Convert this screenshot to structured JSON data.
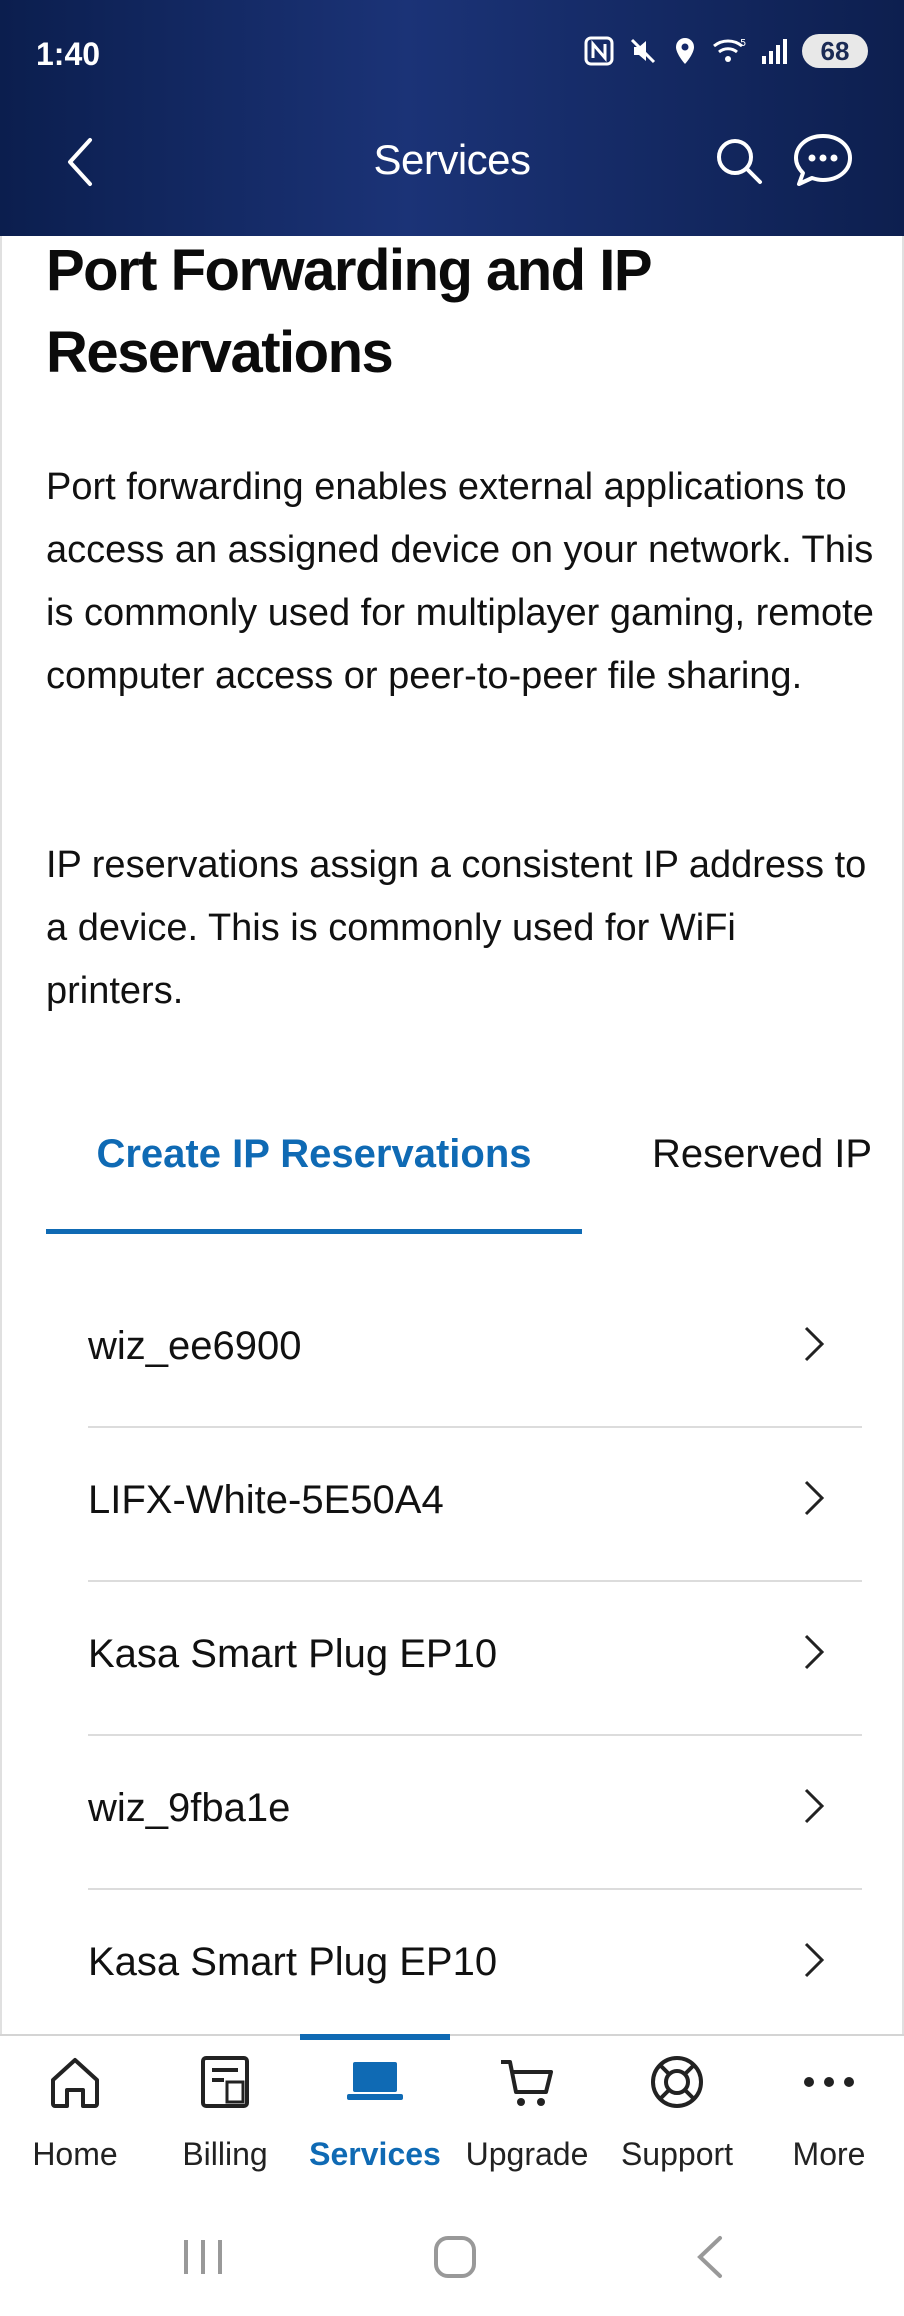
{
  "status_bar": {
    "time": "1:40",
    "battery": "68",
    "icons": [
      "nfc-icon",
      "mute-icon",
      "location-icon",
      "wifi-icon",
      "signal-icon",
      "battery-icon"
    ]
  },
  "header": {
    "title": "Services",
    "back_icon": "back-arrow-icon",
    "search_icon": "search-icon",
    "chat_icon": "chat-icon"
  },
  "main": {
    "heading": "Port Forwarding and IP Reservations",
    "paragraphs": [
      "Port forwarding enables external applications to access an assigned device on your network. This is commonly used for multiplayer gaming, remote computer access or peer-to-peer file sharing.",
      "IP reservations assign a consistent IP address to a device. This is commonly used for WiFi printers."
    ],
    "tabs": [
      {
        "label": "Create IP Reservations",
        "active": true
      },
      {
        "label": "Reserved IP",
        "active": false
      }
    ],
    "devices": [
      {
        "name": "wiz_ee6900"
      },
      {
        "name": "LIFX-White-5E50A4"
      },
      {
        "name": "Kasa Smart Plug EP10"
      },
      {
        "name": "wiz_9fba1e"
      },
      {
        "name": "Kasa Smart Plug EP10"
      }
    ]
  },
  "bottom_nav": {
    "items": [
      {
        "label": "Home",
        "icon": "home-icon"
      },
      {
        "label": "Billing",
        "icon": "billing-icon"
      },
      {
        "label": "Services",
        "icon": "laptop-icon",
        "active": true
      },
      {
        "label": "Upgrade",
        "icon": "cart-icon"
      },
      {
        "label": "Support",
        "icon": "lifebuoy-icon"
      },
      {
        "label": "More",
        "icon": "more-icon"
      }
    ]
  },
  "colors": {
    "accent": "#0f6ab4",
    "header_dark": "#0b1e4e",
    "header_mid": "#1b3377"
  }
}
